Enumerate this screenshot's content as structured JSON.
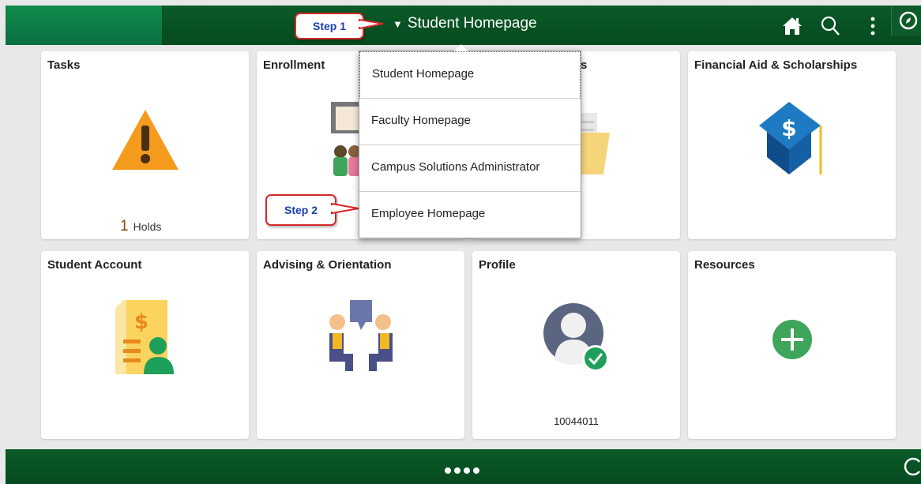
{
  "header": {
    "title": "Student Homepage",
    "caret_icon": "caret-down-icon"
  },
  "callouts": {
    "step1": "Step 1",
    "step2": "Step 2"
  },
  "dropdown": {
    "items": [
      {
        "label": "Student Homepage"
      },
      {
        "label": "Faculty Homepage"
      },
      {
        "label": "Campus Solutions Administrator"
      },
      {
        "label": "Employee Homepage"
      }
    ]
  },
  "tiles": {
    "tasks": {
      "title": "Tasks",
      "count": "1",
      "count_label": "Holds"
    },
    "enrollment": {
      "title": "Enrollment"
    },
    "hidden_tile_suffix": "s",
    "financial_aid": {
      "title": "Financial Aid & Scholarships"
    },
    "student_account": {
      "title": "Student Account"
    },
    "advising": {
      "title": "Advising & Orientation"
    },
    "profile": {
      "title": "Profile",
      "id": "10044011"
    },
    "resources": {
      "title": "Resources"
    }
  },
  "colors": {
    "header_green": "#0a5a28",
    "callout_border": "#d42a2a",
    "callout_text": "#1a3eb0"
  }
}
